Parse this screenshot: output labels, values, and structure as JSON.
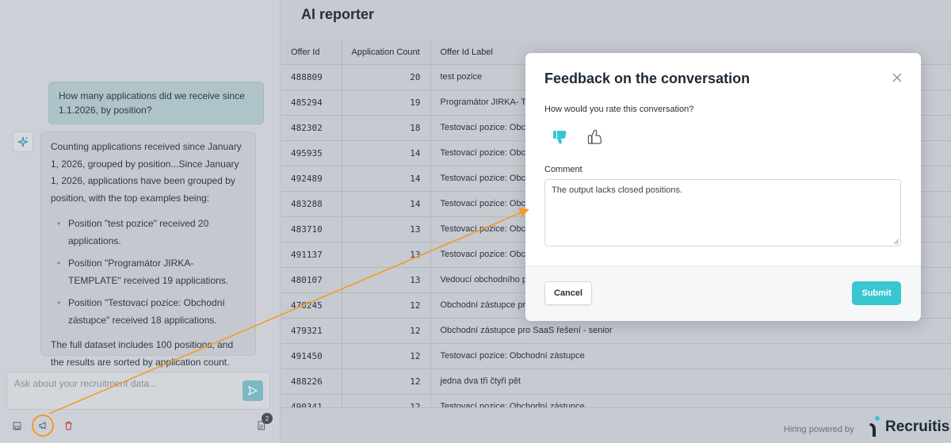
{
  "chat": {
    "user_message": "How many applications did we receive since 1.1.2026, by position?",
    "bot_intro": "Counting applications received since January 1, 2026, grouped by position...Since January 1, 2026, applications have been grouped by position, with the top examples being:",
    "bot_items": [
      "Position \"test pozice\" received 20 applications.",
      "Position \"Programátor JIRKA- TEMPLATE\" received 19 applications.",
      "Position \"Testovací pozice: Obchodní zástupce\" received 18 applications."
    ],
    "bot_outro": "The full dataset includes 100 positions, and the results are sorted by application count.",
    "input_placeholder": "Ask about your recruitment data...",
    "badge_count": "2",
    "icons": {
      "bot": "sparkle-icon",
      "send": "send-icon",
      "save": "save-icon",
      "feedback": "megaphone-icon",
      "delete": "trash-icon",
      "history": "document-icon"
    },
    "colors": {
      "highlight": "#f39a27",
      "delete": "#c0392b"
    }
  },
  "reporter": {
    "title": "AI reporter",
    "columns": [
      "Offer Id",
      "Application Count",
      "Offer Id Label"
    ],
    "rows": [
      [
        "488809",
        "20",
        "test pozice"
      ],
      [
        "485294",
        "19",
        "Programátor JIRKA- TE"
      ],
      [
        "482302",
        "18",
        "Testovací pozice: Obchod"
      ],
      [
        "495935",
        "14",
        "Testovací pozice: Obchod"
      ],
      [
        "492489",
        "14",
        "Testovací pozice: Obcho"
      ],
      [
        "483288",
        "14",
        "Testovací pozice: Obcho"
      ],
      [
        "483710",
        "13",
        "Testovací pozice: Obcho"
      ],
      [
        "491137",
        "13",
        "Testovací pozice: Obcho"
      ],
      [
        "480107",
        "13",
        "Vedoucí obchodního pr"
      ],
      [
        "470245",
        "12",
        "Obchodní zástupce pro"
      ],
      [
        "479321",
        "12",
        "Obchodní zástupce pro SaaS řešení - senior"
      ],
      [
        "491450",
        "12",
        "Testovací pozice: Obchodní zástupce"
      ],
      [
        "488226",
        "12",
        "jedna dva tři čtyři pět"
      ],
      [
        "490341",
        "12",
        "Testovací pozice: Obchodní zástupce"
      ]
    ],
    "footer": {
      "powered_by": "Hiring powered by",
      "brand": "Recruitis"
    }
  },
  "modal": {
    "title": "Feedback on the conversation",
    "rate_label": "How would you rate this conversation?",
    "rating": "thumbs-down",
    "comment_label": "Comment",
    "comment_value": "The output lacks closed positions.",
    "cancel_label": "Cancel",
    "submit_label": "Submit",
    "colors": {
      "accent": "#38c7d1",
      "thumb_down_selected": "#38c7d1"
    }
  }
}
